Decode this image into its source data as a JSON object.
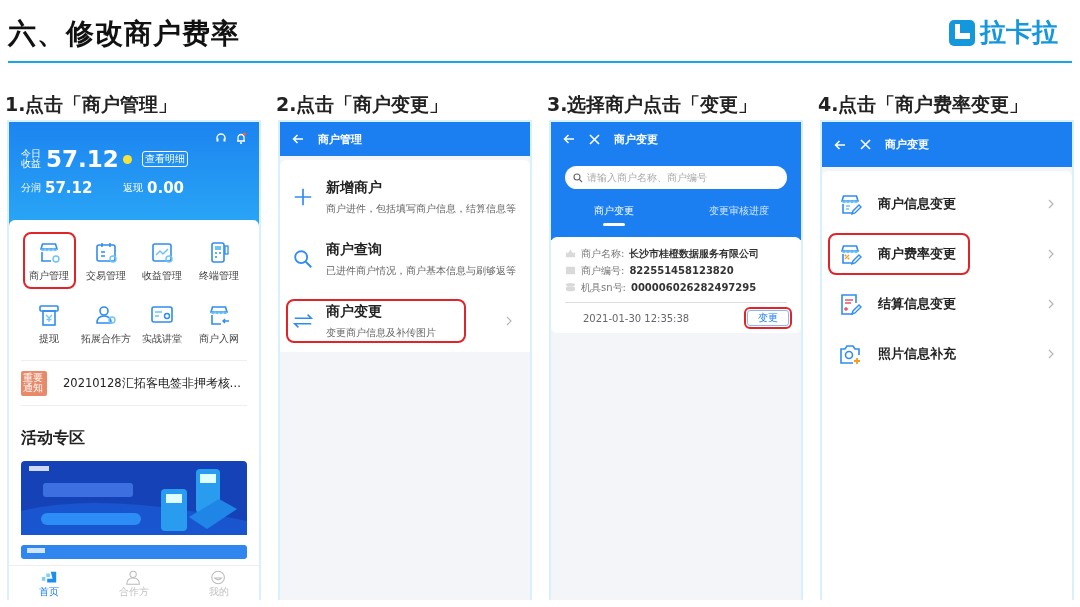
{
  "slide": {
    "title": "六、修改商户费率",
    "logo_text": "拉卡拉"
  },
  "steps": [
    {
      "caption": "1.点击「商户管理」",
      "screen": {
        "kind": "home",
        "today_label": "今日收益",
        "today_amount": "57.12",
        "detail_button": "查看明细",
        "share_label": "分润",
        "share_amount": "57.12",
        "cashback_label": "返现",
        "cashback_amount": "0.00",
        "grid": [
          {
            "label": "商户管理",
            "highlighted": true
          },
          {
            "label": "交易管理",
            "highlighted": false
          },
          {
            "label": "收益管理",
            "highlighted": false
          },
          {
            "label": "终端管理",
            "highlighted": false
          },
          {
            "label": "提现",
            "highlighted": false
          },
          {
            "label": "拓展合作方",
            "highlighted": false
          },
          {
            "label": "实战讲堂",
            "highlighted": false
          },
          {
            "label": "商户入网",
            "highlighted": false
          }
        ],
        "notice": {
          "badge": "重要通知",
          "text": "20210128汇拓客电签非押考核…"
        },
        "section_title": "活动专区",
        "tabs": [
          {
            "label": "首页",
            "selected": true
          },
          {
            "label": "合作方",
            "selected": false
          },
          {
            "label": "我的",
            "selected": false
          }
        ]
      }
    },
    {
      "caption": "2.点击「商户变更」",
      "screen": {
        "kind": "menu",
        "title": "商户管理",
        "items": [
          {
            "title": "新增商户",
            "subtitle": "商户进件，包括填写商户信息，结算信息等",
            "highlighted": false
          },
          {
            "title": "商户查询",
            "subtitle": "已进件商户情况，商户基本信息与刷够返等",
            "highlighted": false
          },
          {
            "title": "商户变更",
            "subtitle": "变更商户信息及补传图片",
            "highlighted": true
          }
        ]
      }
    },
    {
      "caption": "3.选择商户点击「变更」",
      "screen": {
        "kind": "merchant_list",
        "title": "商户变更",
        "search": {
          "placeholder": "请输入商户名称、商户编号"
        },
        "tabs": [
          {
            "label": "商户变更",
            "selected": true
          },
          {
            "label": "变更审核进度",
            "selected": false
          }
        ],
        "record": {
          "fields": [
            {
              "label": "商户名称:",
              "value": "长沙市桂橙数据服务有限公司"
            },
            {
              "label": "商户编号:",
              "value": "822551458123820"
            },
            {
              "label": "机具sn号:",
              "value": "000006026282497295"
            }
          ],
          "time": "2021-01-30 12:35:38",
          "button": {
            "label": "变更",
            "highlighted": true
          }
        }
      }
    },
    {
      "caption": "4.点击「商户费率变更」",
      "screen": {
        "kind": "options",
        "title": "商户变更",
        "items": [
          {
            "label": "商户信息变更",
            "highlighted": false
          },
          {
            "label": "商户费率变更",
            "highlighted": true
          },
          {
            "label": "结算信息变更",
            "highlighted": false
          },
          {
            "label": "照片信息补充",
            "highlighted": false
          }
        ]
      }
    }
  ]
}
